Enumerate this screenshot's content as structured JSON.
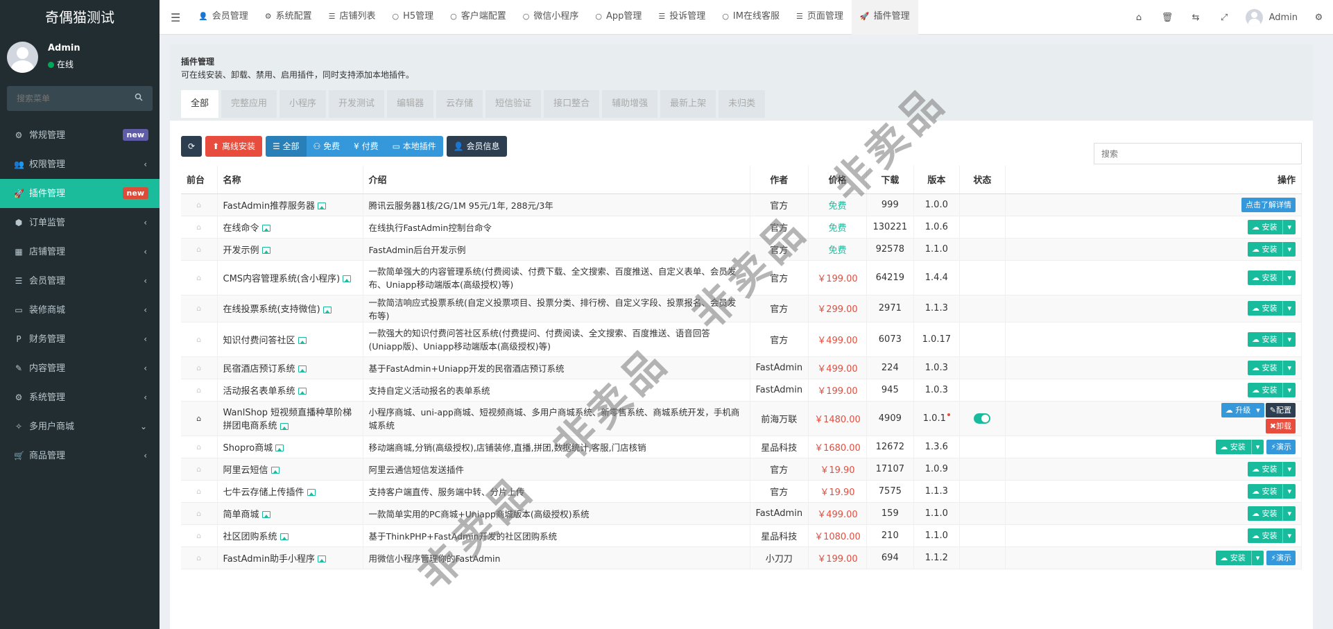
{
  "app": {
    "title": "奇偶猫测试",
    "user_name": "Admin",
    "user_status": "在线",
    "menu_search_placeholder": "搜索菜单"
  },
  "colors": {
    "sidebar_bg": "#222d32",
    "active_green": "#1abc9c",
    "badge_blue": "#605ca8",
    "badge_red": "#dd4b39",
    "price_red": "#e74c3c",
    "free_green": "#18bc9c"
  },
  "sidebar": {
    "items": [
      {
        "label": "常规管理",
        "icon": "cogs-icon",
        "badge": "new",
        "badge_color": "#605ca8"
      },
      {
        "label": "权限管理",
        "icon": "group-icon",
        "chevron": "‹"
      },
      {
        "label": "插件管理",
        "icon": "rocket-icon",
        "badge": "new",
        "badge_color": "#dd4b39",
        "active": true
      },
      {
        "label": "订单监管",
        "icon": "cube-icon",
        "chevron": "‹"
      },
      {
        "label": "店铺管理",
        "icon": "shop-icon",
        "chevron": "‹"
      },
      {
        "label": "会员管理",
        "icon": "list-icon",
        "chevron": "‹"
      },
      {
        "label": "装修商城",
        "icon": "desktop-icon",
        "chevron": "‹"
      },
      {
        "label": "财务管理",
        "icon": "paypal-icon",
        "chevron": "‹"
      },
      {
        "label": "内容管理",
        "icon": "edit-icon",
        "chevron": "‹"
      },
      {
        "label": "系统管理",
        "icon": "gear-icon",
        "chevron": "‹"
      },
      {
        "label": "多用户商城",
        "icon": "magic-icon",
        "chevron": "⌄"
      },
      {
        "label": "商品管理",
        "icon": "cart-icon",
        "chevron": "‹"
      }
    ]
  },
  "topbar": {
    "tabs": [
      {
        "label": "会员管理",
        "icon": "user-icon"
      },
      {
        "label": "系统配置",
        "icon": "gear-icon"
      },
      {
        "label": "店铺列表",
        "icon": "list-icon"
      },
      {
        "label": "H5管理",
        "icon": "circle-icon"
      },
      {
        "label": "客户端配置",
        "icon": "circle-icon"
      },
      {
        "label": "微信小程序",
        "icon": "circle-icon"
      },
      {
        "label": "App管理",
        "icon": "circle-icon"
      },
      {
        "label": "投诉管理",
        "icon": "list-icon"
      },
      {
        "label": "IM在线客服",
        "icon": "circle-icon"
      },
      {
        "label": "页面管理",
        "icon": "list-icon"
      },
      {
        "label": "插件管理",
        "icon": "rocket-icon",
        "active": true
      }
    ],
    "user": "Admin"
  },
  "panel": {
    "title": "插件管理",
    "description": "可在线安装、卸载、禁用、启用插件，同时支持添加本地插件。",
    "categories": [
      "全部",
      "完整应用",
      "小程序",
      "开发测试",
      "编辑器",
      "云存储",
      "短信验证",
      "接口整合",
      "辅助增强",
      "最新上架",
      "未归类"
    ],
    "active_category": "全部"
  },
  "toolbar": {
    "offline_install": "离线安装",
    "filter_all": "全部",
    "filter_free": "免费",
    "filter_paid": "付费",
    "filter_local": "本地插件",
    "member_info": "会员信息",
    "search_placeholder": "搜索"
  },
  "table": {
    "columns": [
      "前台",
      "名称",
      "介绍",
      "作者",
      "价格",
      "下载",
      "版本",
      "状态",
      "操作"
    ],
    "rows": [
      {
        "name": "FastAdmin推荐服务器",
        "intro": "腾讯云服务器1核/2G/1M 95元/1年, 288元/3年",
        "author": "官方",
        "price": "免费",
        "free": true,
        "downloads": "999",
        "version": "1.0.0",
        "action": "info",
        "info_label": "点击了解详情"
      },
      {
        "name": "在线命令",
        "intro": "在线执行FastAdmin控制台命令",
        "author": "官方",
        "price": "免费",
        "free": true,
        "downloads": "130221",
        "version": "1.0.6",
        "action": "install"
      },
      {
        "name": "开发示例",
        "intro": "FastAdmin后台开发示例",
        "author": "官方",
        "price": "免费",
        "free": true,
        "downloads": "92578",
        "version": "1.1.0",
        "action": "install"
      },
      {
        "name": "CMS内容管理系统(含小程序)",
        "intro": "一款简单强大的内容管理系统(付费阅读、付费下载、全文搜索、百度推送、自定义表单、会员发布、Uniapp移动端版本(高级授权)等)",
        "author": "官方",
        "price": "￥199.00",
        "downloads": "64219",
        "version": "1.4.4",
        "action": "install",
        "tall": true
      },
      {
        "name": "在线投票系统(支持微信)",
        "intro": "一款简洁响应式投票系统(自定义投票项目、投票分类、排行榜、自定义字段、投票报名、会员发布等)",
        "author": "官方",
        "price": "￥299.00",
        "downloads": "2971",
        "version": "1.1.3",
        "action": "install"
      },
      {
        "name": "知识付费问答社区",
        "intro": "一款强大的知识付费问答社区系统(付费提问、付费阅读、全文搜索、百度推送、语音回答(Uniapp版)、Uniapp移动端版本(高级授权)等)",
        "author": "官方",
        "price": "￥499.00",
        "downloads": "6073",
        "version": "1.0.17",
        "action": "install",
        "tall": true
      },
      {
        "name": "民宿酒店预订系统",
        "intro": "基于FastAdmin+Uniapp开发的民宿酒店预订系统",
        "author": "FastAdmin",
        "price": "￥499.00",
        "downloads": "224",
        "version": "1.0.3",
        "action": "install"
      },
      {
        "name": "活动报名表单系统",
        "intro": "支持自定义活动报名的表单系统",
        "author": "FastAdmin",
        "price": "￥199.00",
        "downloads": "945",
        "version": "1.0.3",
        "action": "install"
      },
      {
        "name": "WanlShop 短视频直播种草阶梯拼团电商系统",
        "intro": "小程序商城、uni-app商城、短视频商城、多用户商城系统、新零售系统、商城系统开发，手机商城系统",
        "author": "前海万联",
        "price": "￥1480.00",
        "downloads": "4909",
        "version": "1.0.1",
        "action": "upgrade",
        "home_on": true,
        "enabled": true,
        "tall": true,
        "upgrade_label": "升级",
        "config_label": "配置",
        "uninstall_label": "卸载"
      },
      {
        "name": "Shopro商城",
        "intro": "移动端商城,分销(高级授权),店铺装修,直播,拼团,数据统计,客服,门店核销",
        "author": "星品科技",
        "price": "￥1680.00",
        "downloads": "12672",
        "version": "1.3.6",
        "action": "install_demo"
      },
      {
        "name": "阿里云短信",
        "intro": "阿里云通信短信发送插件",
        "author": "官方",
        "price": "￥19.90",
        "downloads": "17107",
        "version": "1.0.9",
        "action": "install"
      },
      {
        "name": "七牛云存储上传插件",
        "intro": "支持客户端直传、服务端中转、分片上传",
        "author": "官方",
        "price": "￥19.90",
        "downloads": "7575",
        "version": "1.1.3",
        "action": "install"
      },
      {
        "name": "简单商城",
        "intro": "一款简单实用的PC商城+Uniapp商城版本(高级授权)系统",
        "author": "FastAdmin",
        "price": "￥499.00",
        "downloads": "159",
        "version": "1.1.0",
        "action": "install"
      },
      {
        "name": "社区团购系统",
        "intro": "基于ThinkPHP+FastAdmin开发的社区团购系统",
        "author": "星品科技",
        "price": "￥1080.00",
        "downloads": "210",
        "version": "1.1.0",
        "action": "install"
      },
      {
        "name": "FastAdmin助手小程序",
        "intro": "用微信小程序管理你的FastAdmin",
        "author": "小刀刀",
        "price": "￥199.00",
        "downloads": "694",
        "version": "1.1.2",
        "action": "install_demo"
      }
    ],
    "install_label": "安装",
    "demo_label": "演示"
  },
  "watermark": "非卖品"
}
